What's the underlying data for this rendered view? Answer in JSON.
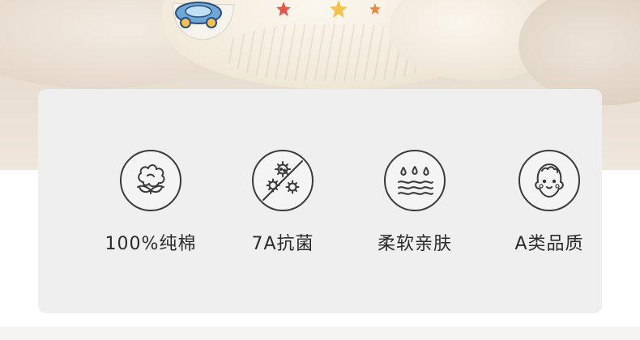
{
  "features": [
    {
      "icon": "cotton-icon",
      "label": "100%纯棉"
    },
    {
      "icon": "antibacterial-icon",
      "label": "7A抗菌"
    },
    {
      "icon": "water-drops-icon",
      "label": "柔软亲肤"
    },
    {
      "icon": "baby-face-icon",
      "label": "A类品质"
    }
  ],
  "colors": {
    "card_background": "#efefef",
    "icon_stroke": "#3a3a3a",
    "text": "#2b2b2b"
  }
}
